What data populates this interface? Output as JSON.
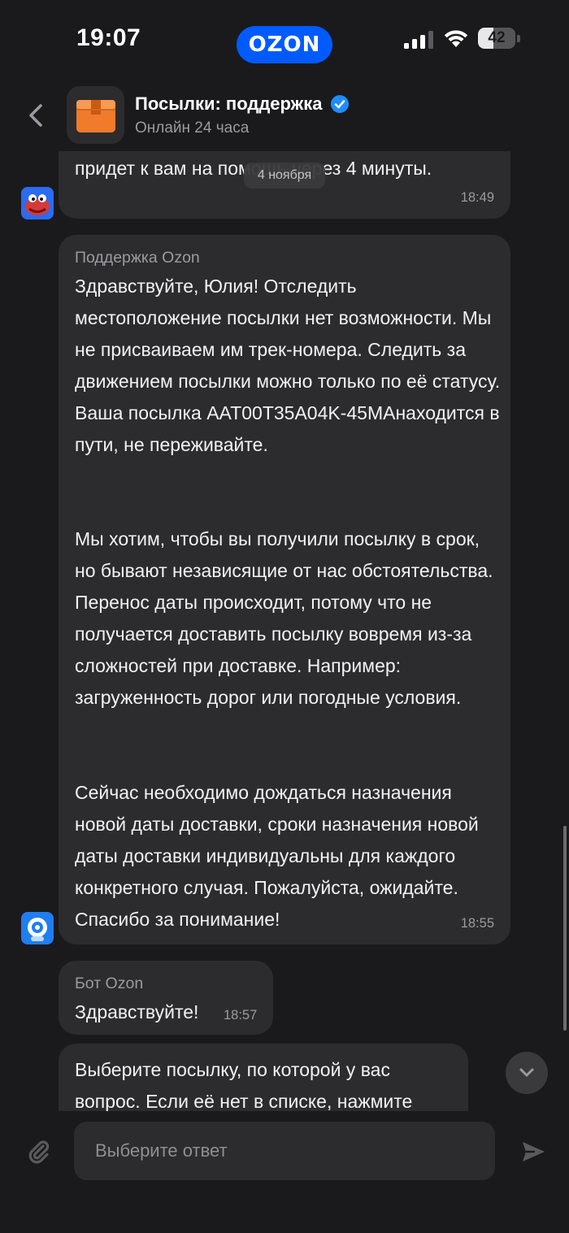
{
  "status_bar": {
    "time": "19:07",
    "brand": "OZON",
    "battery_level": "42",
    "battery_fraction": 0.42
  },
  "header": {
    "title": "Посылки: поддержка",
    "subtitle": "Онлайн 24 часа",
    "verified_color": "#1f8cff"
  },
  "date_chip": "4 ноября",
  "messages": [
    {
      "sender": "",
      "text": "придет к вам на помощь через 4 минуты.",
      "time": "18:49",
      "avatar": "monster-mascot-icon"
    },
    {
      "sender": "Поддержка Ozon",
      "paragraphs": [
        "Здравствуйте, Юлия! Отследить местоположение посылки нет возможности. Мы не присваиваем им трек-номера. Следить за движением посылки можно только по её статусу. Ваша посылка AAT00T35A04K-45MAнаходится в пути, не переживайте.",
        "Мы хотим, чтобы вы получили посылку в срок, но бывают независящие от нас обстоятельства. Перенос даты происходит, потому что не получается доставить посылку вовремя из-за сложностей при доставке. Например: загруженность дорог или погодные условия.",
        "Сейчас необходимо дождаться назначения новой даты доставки, сроки назначения новой даты доставки индивидуальны для каждого конкретного случая. Пожалуйста, ожидайте. Спасибо за понимание!"
      ],
      "time": "18:55",
      "avatar": "support-bot-icon"
    },
    {
      "sender": "Бот Ozon",
      "text": "Здравствуйте!",
      "time": "18:57"
    },
    {
      "sender": "",
      "text": "Выберите посылку, по которой у вас вопрос. Если её нет в списке, нажмите",
      "time": ""
    }
  ],
  "input": {
    "placeholder": "Выберите ответ"
  },
  "colors": {
    "background": "#1a1a1c",
    "bubble": "#2c2c2e",
    "brand_blue": "#005bff",
    "avatar_orange": "#f07b2a"
  }
}
